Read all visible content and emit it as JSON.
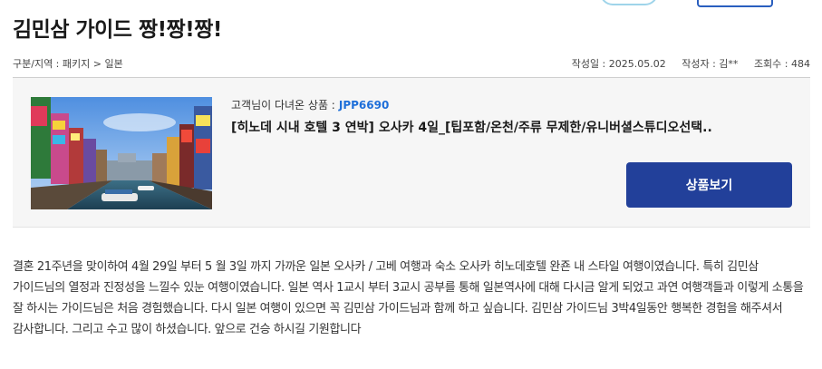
{
  "page": {
    "title": "김민삼 가이드 짱!짱!짱!"
  },
  "meta": {
    "category": "구분/지역 : 패키지 > 일본",
    "date": "작성일 : 2025.05.02",
    "author": "작성자 : 김**",
    "views": "조회수 : 484"
  },
  "product": {
    "visited_label": "고객님이 다녀온 상품 :",
    "product_code": "JPP6690",
    "name": "[히노데 시내 호텔 3 연박] 오사카 4일_[팁포함/온천/주류 무제한/유니버셜스튜디오선택..",
    "view_button": "상품보기",
    "thumbnail": "osaka-dotonbori-photo"
  },
  "review": {
    "body": "결혼 21주년을 맞이하여 4월 29일 부터 5 월 3일 까지 가까운 일본 오사카 / 고베 여행과 숙소 오사카 히노데호텔 완죤 내 스타일 여행이였습니다. 특히 김민삼 가이드님의 열정과 진정성을 느낄수 있눈 여행이였습니다. 일본 역사 1교시 부터 3교시 공부를 통해 일본역사에 대해 다시금 알게 되었고 과연 여행객들과 이렇게 소통을 잘 하시는 가이드님은 처음 경험했습니다. 다시 일본 여행이 있으면 꼭 김민삼 가이드님과 함께 하고 싶습니다. 김민삼 가이드님 3박4일동안 행복한 경험을 해주셔서 감사합니다. 그리고 수고 많이 하셨습니다. 앞으로 건승 하시길 기원합니다"
  },
  "colors": {
    "accent": "#22409a",
    "code": "#1e6fd9",
    "box_bg": "#f6f6f6"
  }
}
